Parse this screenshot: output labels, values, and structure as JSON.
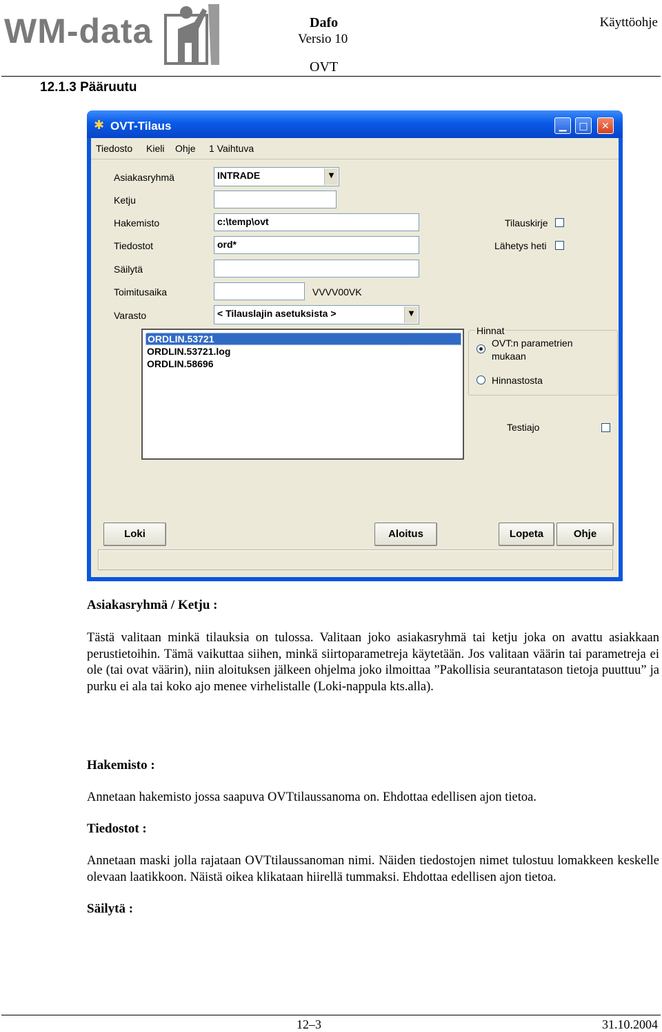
{
  "header": {
    "logo_text": "WM-data",
    "title": "Dafo",
    "version": "Versio 10",
    "subtitle": "OVT",
    "doc_type": "Käyttöohje"
  },
  "section_title": "12.1.3 Pääruutu",
  "window": {
    "title": "OVT-Tilaus",
    "menu": [
      "Tiedosto",
      "Kieli",
      "Ohje",
      "1 Vaihtuva"
    ],
    "labels": {
      "asiakasryhma": "Asiakasryhmä",
      "ketju": "Ketju",
      "hakemisto": "Hakemisto",
      "tiedostot": "Tiedostot",
      "sailyta": "Säilytä",
      "toimitusaika": "Toimitusaika",
      "varasto": "Varasto",
      "date_hint": "VVVV00VK",
      "tilauskirje": "Tilauskirje",
      "lahetys_heti": "Lähetys heti",
      "testiajo": "Testiajo"
    },
    "values": {
      "asiakasryhma": "INTRADE",
      "ketju": "",
      "hakemisto": "c:\\temp\\ovt",
      "tiedostot": "ord*",
      "sailyta": "",
      "toimitusaika": "",
      "varasto": "< Tilauslajin asetuksista >"
    },
    "file_list": [
      "ORDLIN.53721",
      "ORDLIN.53721.log",
      "ORDLIN.58696"
    ],
    "hinnat": {
      "legend": "Hinnat",
      "option1_line1": "OVT:n parametrien",
      "option1_line2": "mukaan",
      "option2": "Hinnastosta"
    },
    "buttons": {
      "loki": "Loki",
      "aloitus": "Aloitus",
      "lopeta": "Lopeta",
      "ohje": "Ohje"
    }
  },
  "content": {
    "h_asiakasryhma": "Asiakasryhmä / Ketju :",
    "p_asiakasryhma": "Tästä valitaan minkä tilauksia on tulossa. Valitaan joko asiakasryhmä tai ketju joka on avattu asiakkaan perustietoihin. Tämä vaikuttaa siihen, minkä siirtoparametreja käytetään. Jos valitaan väärin tai parametreja ei ole (tai ovat väärin), niin aloituksen jälkeen ohjelma joko ilmoittaa ”Pakollisia seurantatason tietoja puuttuu” ja purku ei ala tai koko ajo menee virhelistalle (Loki-nappula kts.alla).",
    "h_hakemisto": "Hakemisto :",
    "p_hakemisto": "Annetaan hakemisto jossa saapuva OVTtilaussanoma on. Ehdottaa edellisen ajon tietoa.",
    "h_tiedostot": "Tiedostot :",
    "p_tiedostot": "Annetaan maski jolla rajataan OVTtilaussanoman nimi. Näiden tiedostojen nimet tulostuu lomakkeen keskelle olevaan laatikkoon. Näistä oikea klikataan hiirellä tummaksi. Ehdottaa edellisen ajon tietoa.",
    "h_sailyta": "Säilytä :"
  },
  "footer": {
    "page": "12–3",
    "date": "31.10.2004"
  },
  "colors": {
    "titlebar": "#0a56e0",
    "window_face": "#ece9d8",
    "selection": "#316ac5"
  }
}
